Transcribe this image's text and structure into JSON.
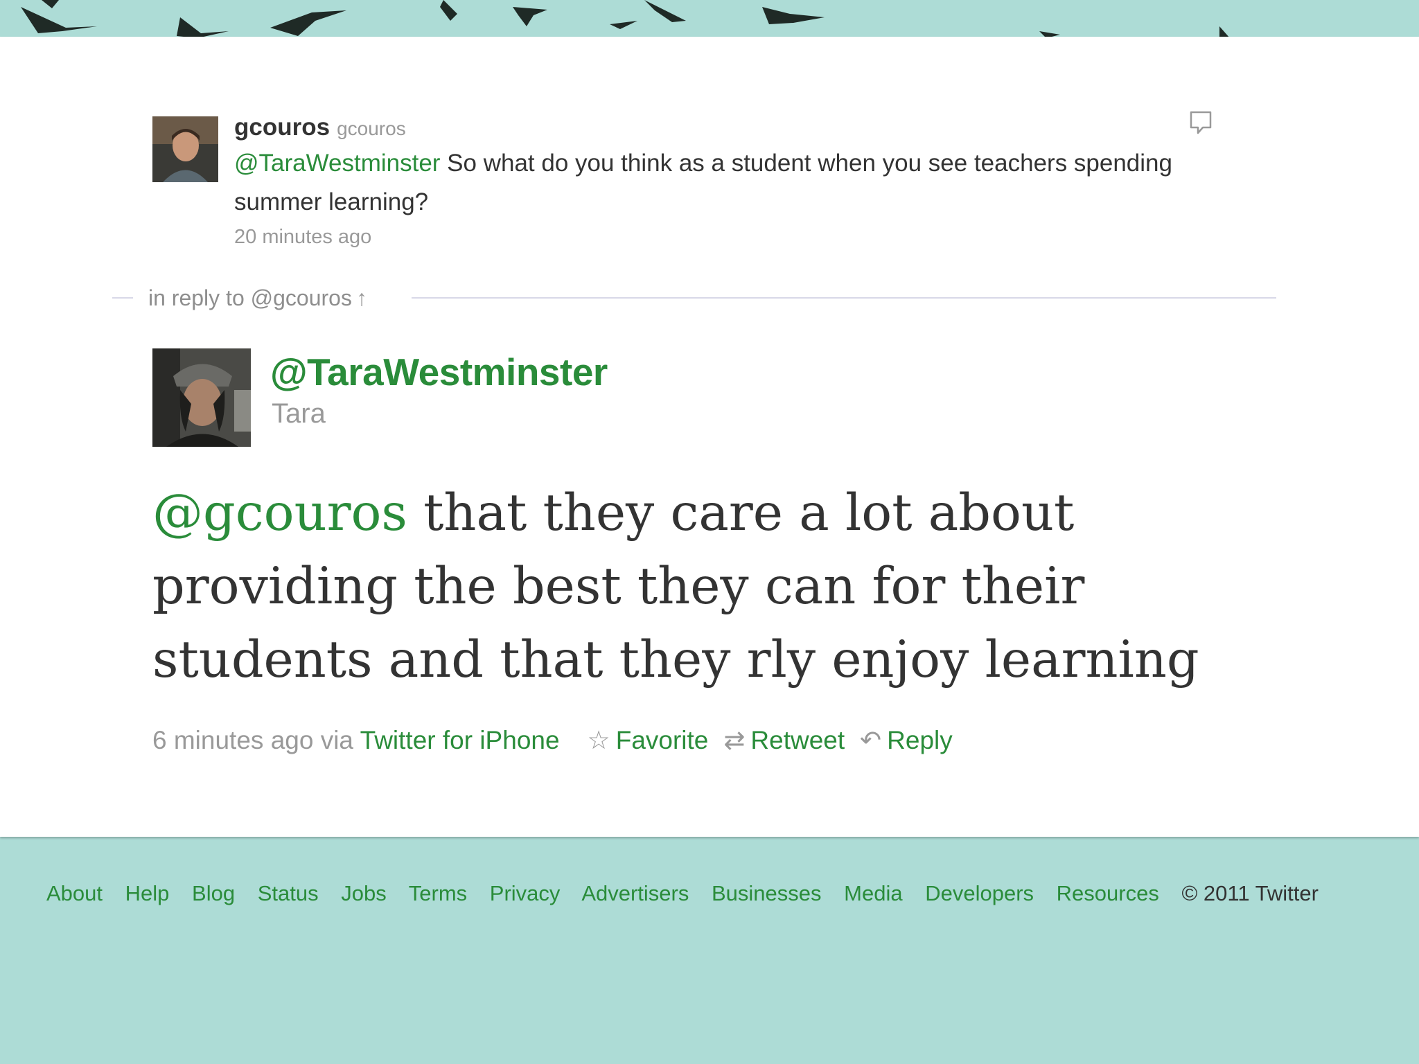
{
  "colors": {
    "background": "#addcd6",
    "panel": "#ffffff",
    "link_green": "#2a8c3a",
    "text": "#333333",
    "muted": "#999999"
  },
  "original_tweet": {
    "screen_name": "gcouros",
    "handle": "gcouros",
    "mention": "@TaraWestminster",
    "text": " So what do you think as a student when you see teachers spending summer learning?",
    "timestamp": "20 minutes ago",
    "avatar_icon": "avatar-photo",
    "reply_icon": "speech-bubble-icon"
  },
  "reply_context": {
    "label": "in reply to @gcouros",
    "arrow_icon": "up-arrow-icon"
  },
  "main_tweet": {
    "screen_name": "@TaraWestminster",
    "full_name": "Tara",
    "mention": "@gcouros",
    "text": " that they care a lot about providing the best they can for their students and that they rly enjoy learning",
    "timestamp": "6 minutes ago via",
    "source": "Twitter for iPhone",
    "actions": {
      "favorite": "Favorite",
      "retweet": "Retweet",
      "reply": "Reply"
    },
    "icons": {
      "favorite": "star-icon",
      "retweet": "retweet-icon",
      "reply": "reply-arrow-icon"
    }
  },
  "footer": {
    "links": [
      "About",
      "Help",
      "Blog",
      "Status",
      "Jobs",
      "Terms",
      "Privacy",
      "Advertisers",
      "Businesses",
      "Media",
      "Developers",
      "Resources"
    ],
    "copyright": "© 2011 Twitter"
  }
}
